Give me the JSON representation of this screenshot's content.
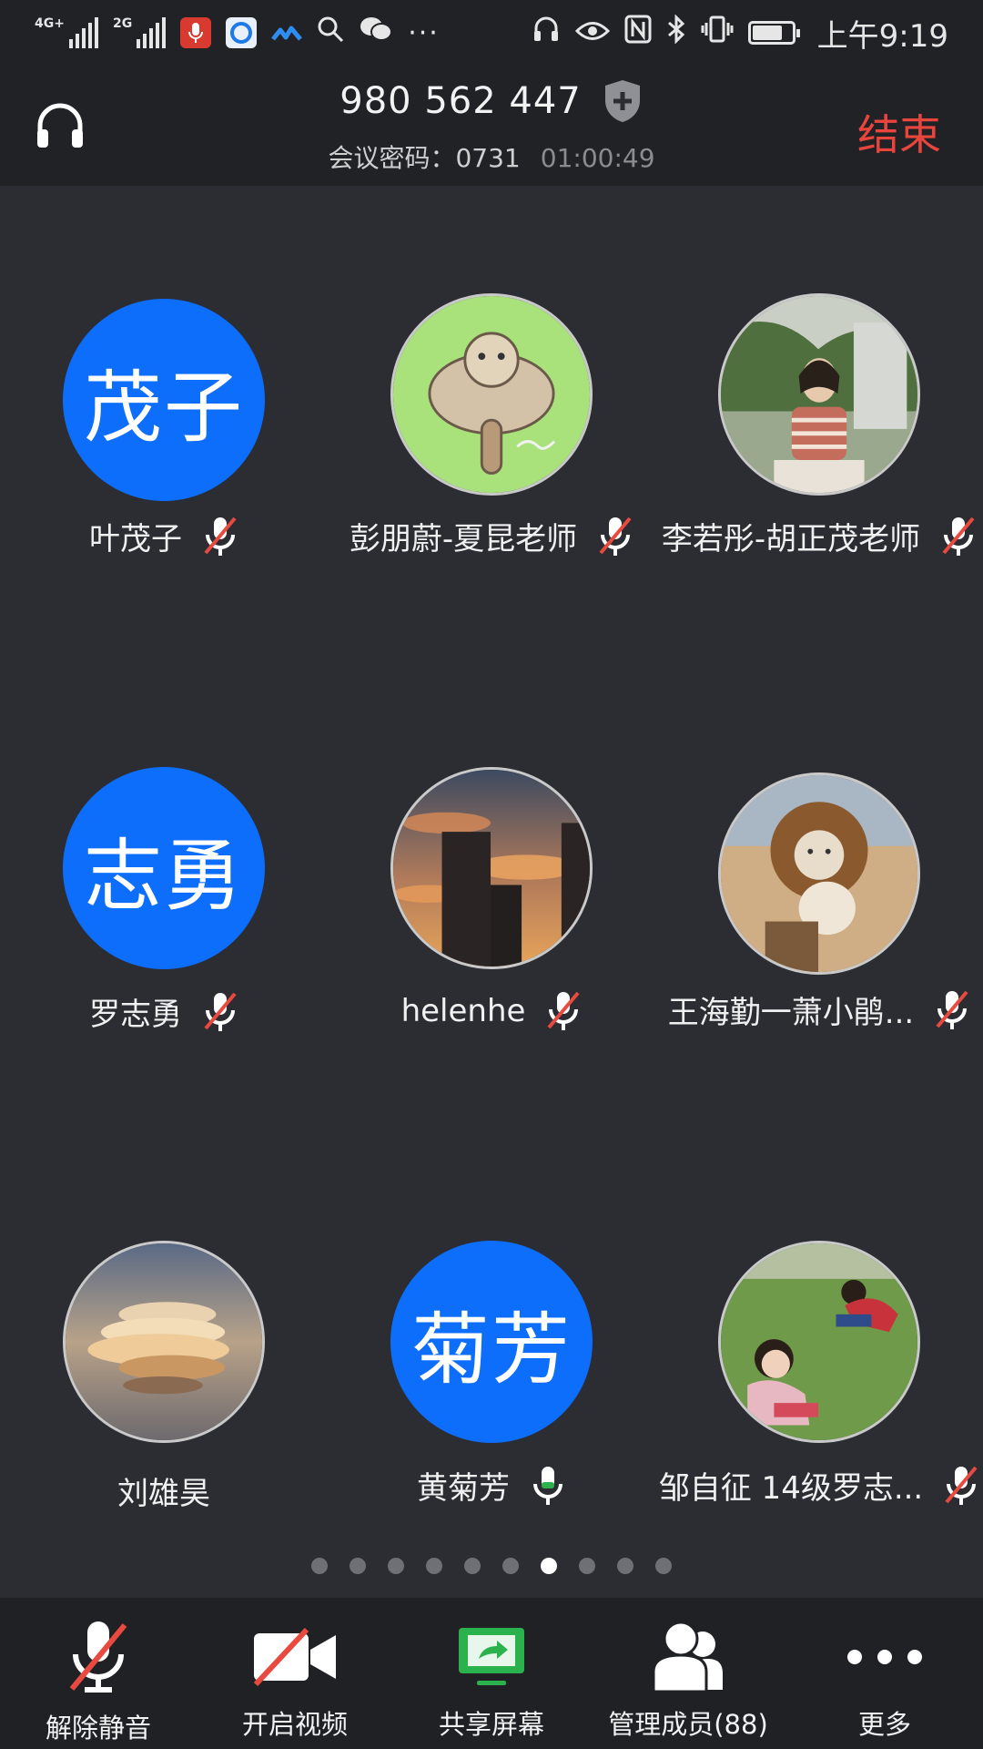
{
  "status_bar": {
    "net1": "4G+",
    "net2": "2G",
    "time": "上午9:19",
    "battery_level": 0.7,
    "icons": [
      "signal-icon",
      "signal-icon",
      "mic-app-icon",
      "browser-icon",
      "app-icon",
      "search-icon",
      "wechat-icon",
      "more-icon",
      "headset-icon",
      "eye-icon",
      "nfc-icon",
      "bluetooth-icon",
      "vibrate-icon",
      "battery-icon"
    ]
  },
  "header": {
    "meeting_id": "980 562 447",
    "password_label": "会议密码：",
    "password": "0731",
    "duration": "01:00:49",
    "end_label": "结束"
  },
  "participants": [
    {
      "name": "叶茂子",
      "avatar_text": "茂子",
      "muted": true
    },
    {
      "name": "彭朋蔚-夏昆老师",
      "avatar_image": "flying-squirrel-avatar",
      "muted": true
    },
    {
      "name": "李若彤-胡正茂老师",
      "avatar_image": "girl-photo-avatar",
      "muted": true
    },
    {
      "name": "罗志勇",
      "avatar_text": "志勇",
      "muted": true
    },
    {
      "name": "helenhe",
      "avatar_image": "sunset-buildings-avatar",
      "muted": true
    },
    {
      "name": "王海勤一萧小鹃...",
      "avatar_image": "lion-cat-avatar",
      "muted": true
    },
    {
      "name": "刘雄昊",
      "avatar_image": "cloud-avatar",
      "muted": null
    },
    {
      "name": "黄菊芳",
      "avatar_text": "菊芳",
      "muted": false
    },
    {
      "name": "邹自征 14级罗志...",
      "avatar_image": "kids-on-grass-avatar",
      "muted": true
    }
  ],
  "pagination": {
    "total": 10,
    "active_index": 6
  },
  "toolbar": {
    "unmute": "解除静音",
    "video": "开启视频",
    "share": "共享屏幕",
    "members": "管理成员(88)",
    "more": "更多"
  },
  "colors": {
    "background": "#2b2d33",
    "header": "#202226",
    "accent_blue": "#0d6efb",
    "end_red": "#e8453c",
    "share_green": "#2bb24c",
    "mute_red": "#e84a3f"
  }
}
